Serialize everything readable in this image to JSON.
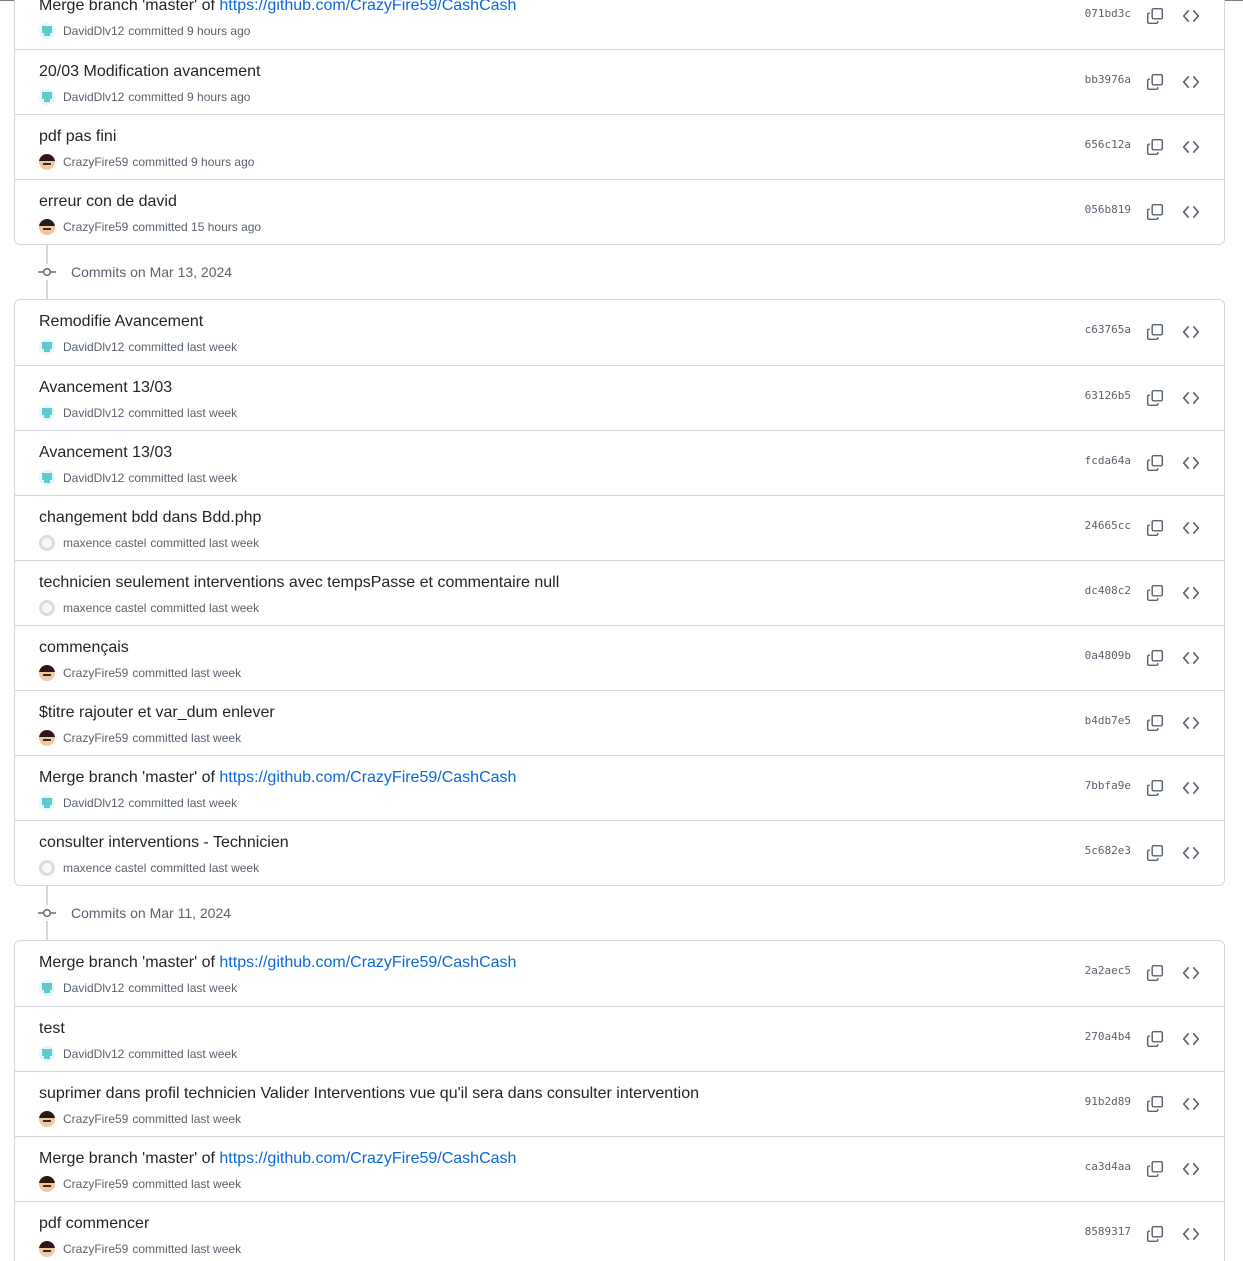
{
  "groups": [
    {
      "date_label": "",
      "commits": [
        {
          "title": "Merge branch 'master' of ",
          "link": "https://github.com/CrazyFire59/CashCash",
          "author": "DavidDlv12",
          "avatar": "david",
          "time": "committed 9 hours ago",
          "sha": "071bd3c"
        },
        {
          "title": "20/03 Modification avancement",
          "link": "",
          "author": "DavidDlv12",
          "avatar": "david",
          "time": "committed 9 hours ago",
          "sha": "bb3976a"
        },
        {
          "title": "pdf pas fini",
          "link": "",
          "author": "CrazyFire59",
          "avatar": "crazy",
          "time": "committed 9 hours ago",
          "sha": "656c12a"
        },
        {
          "title": "erreur con de david",
          "link": "",
          "author": "CrazyFire59",
          "avatar": "crazy",
          "time": "committed 15 hours ago",
          "sha": "056b819"
        }
      ]
    },
    {
      "date_label": "Commits on Mar 13, 2024",
      "commits": [
        {
          "title": "Remodifie Avancement",
          "link": "",
          "author": "DavidDlv12",
          "avatar": "david",
          "time": "committed last week",
          "sha": "c63765a"
        },
        {
          "title": "Avancement 13/03",
          "link": "",
          "author": "DavidDlv12",
          "avatar": "david",
          "time": "committed last week",
          "sha": "63126b5"
        },
        {
          "title": "Avancement 13/03",
          "link": "",
          "author": "DavidDlv12",
          "avatar": "david",
          "time": "committed last week",
          "sha": "fcda64a"
        },
        {
          "title": "changement bdd dans Bdd.php",
          "link": "",
          "author": "maxence castel",
          "avatar": "maxence",
          "time": "committed last week",
          "sha": "24665cc"
        },
        {
          "title": "technicien seulement interventions avec tempsPasse et commentaire null",
          "link": "",
          "author": "maxence castel",
          "avatar": "maxence",
          "time": "committed last week",
          "sha": "dc408c2"
        },
        {
          "title": "commençais",
          "link": "",
          "author": "CrazyFire59",
          "avatar": "crazy",
          "time": "committed last week",
          "sha": "0a4809b"
        },
        {
          "title": "$titre rajouter et var_dum enlever",
          "link": "",
          "author": "CrazyFire59",
          "avatar": "crazy",
          "time": "committed last week",
          "sha": "b4db7e5"
        },
        {
          "title": "Merge branch 'master' of ",
          "link": "https://github.com/CrazyFire59/CashCash",
          "author": "DavidDlv12",
          "avatar": "david",
          "time": "committed last week",
          "sha": "7bbfa9e"
        },
        {
          "title": "consulter interventions - Technicien",
          "link": "",
          "author": "maxence castel",
          "avatar": "maxence",
          "time": "committed last week",
          "sha": "5c682e3"
        }
      ]
    },
    {
      "date_label": "Commits on Mar 11, 2024",
      "commits": [
        {
          "title": "Merge branch 'master' of ",
          "link": "https://github.com/CrazyFire59/CashCash",
          "author": "DavidDlv12",
          "avatar": "david",
          "time": "committed last week",
          "sha": "2a2aec5"
        },
        {
          "title": "test",
          "link": "",
          "author": "DavidDlv12",
          "avatar": "david",
          "time": "committed last week",
          "sha": "270a4b4"
        },
        {
          "title": "suprimer dans profil technicien Valider Interventions vue qu'il sera dans consulter intervention",
          "link": "",
          "author": "CrazyFire59",
          "avatar": "crazy",
          "time": "committed last week",
          "sha": "91b2d89"
        },
        {
          "title": "Merge branch 'master' of ",
          "link": "https://github.com/CrazyFire59/CashCash",
          "author": "CrazyFire59",
          "avatar": "crazy",
          "time": "committed last week",
          "sha": "ca3d4aa"
        },
        {
          "title": "pdf commencer",
          "link": "",
          "author": "CrazyFire59",
          "avatar": "crazy",
          "time": "committed last week",
          "sha": "8589317"
        }
      ]
    }
  ],
  "icons": {
    "copy": "copy-icon",
    "browse": "code-icon",
    "timeline": "git-commit-icon"
  },
  "colors": {
    "link": "#0969da",
    "border": "#d0d7de",
    "muted": "#59636e",
    "text": "#1f2328"
  }
}
